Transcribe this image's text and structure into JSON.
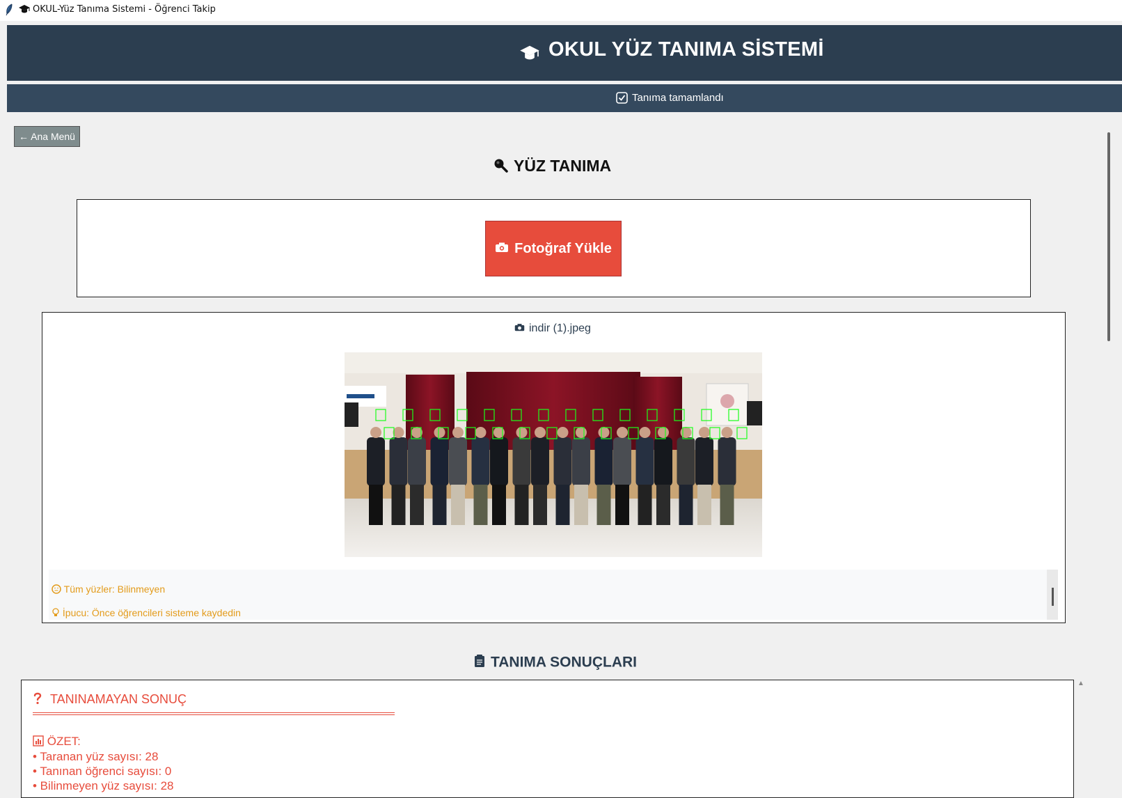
{
  "window": {
    "title": "OKUL-Yüz Tanıma Sistemi - Öğrenci Takip",
    "icon": "feather-icon",
    "title_icon": "graduation-cap-icon"
  },
  "header": {
    "title": "OKUL YÜZ TANIMA SİSTEMİ",
    "icon": "graduation-cap-icon",
    "background": "#2c3e50"
  },
  "status": {
    "text": "Tanıma tamamlandı",
    "icon": "checkbox-checked-icon",
    "background": "#34495e"
  },
  "nav": {
    "back_label": "← Ana Menü"
  },
  "page": {
    "heading": "YÜZ TANIMA",
    "heading_icon": "magnifier-icon"
  },
  "upload": {
    "button_label": "Fotoğraf Yükle",
    "button_icon": "camera-icon",
    "button_color": "#e74c3c"
  },
  "preview": {
    "file_icon": "camera-icon",
    "file_name": "indir (1).jpeg",
    "face_count": 28,
    "info_lines": [
      {
        "icon": "smiley-icon",
        "text": "Tüm yüzler: Bilinmeyen"
      },
      {
        "icon": "lightbulb-icon",
        "text": "İpucu: Önce öğrencileri sisteme kaydedin"
      }
    ],
    "info_color": "#e39b1a"
  },
  "results": {
    "heading": "TANIMA SONUÇLARI",
    "heading_icon": "clipboard-icon",
    "status_icon": "question-icon",
    "status_title": "TANINAMAYAN SONUÇ",
    "summary_icon": "bar-chart-icon",
    "summary_title": "ÖZET:",
    "lines": [
      "• Taranan yüz sayısı: 28",
      "• Tanınan öğrenci sayısı: 0",
      "• Bilinmeyen yüz sayısı: 28"
    ],
    "color": "#e74c3c"
  }
}
